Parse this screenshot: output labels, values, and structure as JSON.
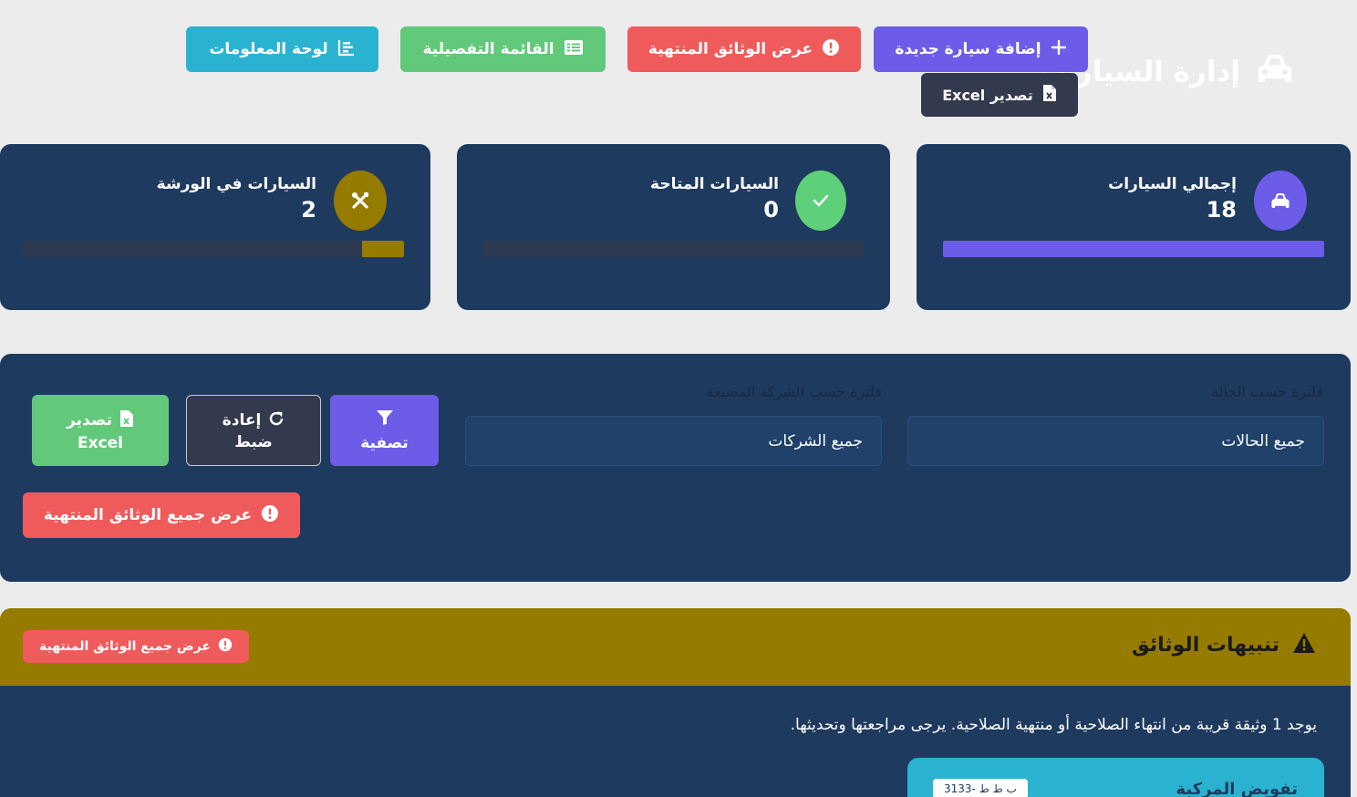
{
  "header": {
    "title": "إدارة السيارات",
    "buttons": {
      "add_car": "إضافة سيارة جديدة",
      "expired_docs": "عرض الوثائق المنتهية",
      "detailed_list": "القائمة التفصيلية",
      "dashboard": "لوحة المعلومات",
      "export_excel": "تصدير Excel"
    }
  },
  "stats": [
    {
      "label": "إجمالي السيارات",
      "value": "18",
      "color": "#6c5ce7",
      "fill": 1.0
    },
    {
      "label": "السيارات المتاحة",
      "value": "0",
      "color": "#5fd07a",
      "fill": 0.0
    },
    {
      "label": "السيارات في الورشة",
      "value": "2",
      "color": "#957b00",
      "fill": 0.11
    }
  ],
  "filters": {
    "status_label": "فلترة حسب الحالة",
    "status_value": "جميع الحالات",
    "company_label": "فلترة حسب الشركة المصنعة",
    "company_value": "جميع الشركات",
    "filter_btn": "تصفية",
    "reset_btn_line1": "إعادة",
    "reset_btn_line2": "ضبط",
    "export_line1": "تصدير",
    "export_line2": "Excel",
    "show_all_expired": "عرض جميع الوثائق المنتهية"
  },
  "alerts": {
    "title": "تنبيهات الوثائق",
    "show_all": "عرض جميع الوثائق المنتهية",
    "message": "يوجد 1 وثيقة قريبة من انتهاء الصلاحية أو منتهية الصلاحية. يرجى مراجعتها وتحديثها.",
    "card_title": "تفويض المركبة",
    "plate": "3133- ب ط ط"
  },
  "colors": {
    "purple": "#6c5ce7",
    "red": "#ef5b5b",
    "green": "#5fcf7c",
    "teal": "#26b5d3",
    "navy": "#1e3a5f",
    "olive": "#957b00",
    "dark": "#343a4e"
  }
}
